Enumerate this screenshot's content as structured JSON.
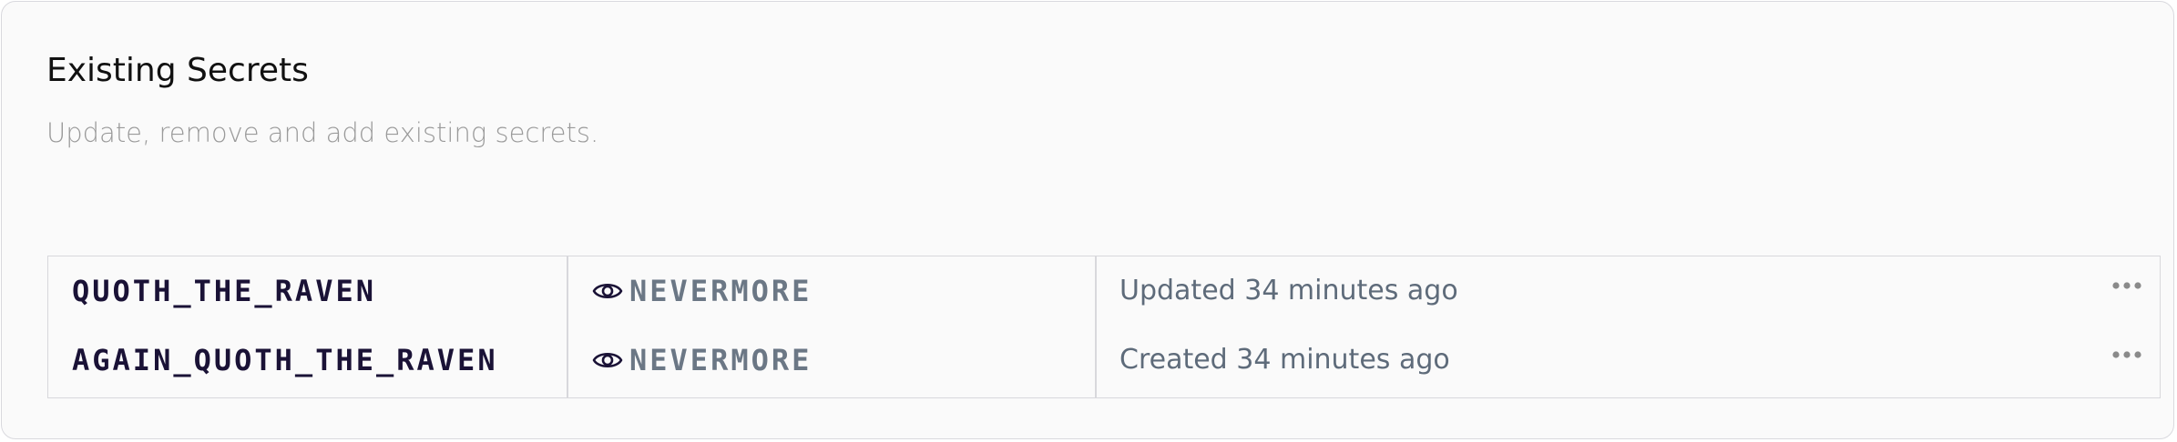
{
  "section": {
    "title": "Existing Secrets",
    "subtitle": "Update, remove and add existing secrets."
  },
  "secrets": [
    {
      "name": "QUOTH_THE_RAVEN",
      "value": "NEVERMORE",
      "status": "Updated 34 minutes ago",
      "reveal_icon": "eye-icon",
      "menu_icon": "more-horizontal-icon"
    },
    {
      "name": "AGAIN_QUOTH_THE_RAVEN",
      "value": "NEVERMORE",
      "status": "Created 34 minutes ago",
      "reveal_icon": "eye-icon",
      "menu_icon": "more-horizontal-icon"
    }
  ],
  "colors": {
    "card_background": "#fafafa",
    "border": "#d8d8dc",
    "title": "#111111",
    "subtitle": "#9a9a9a",
    "secret_name": "#1a1236",
    "secret_value": "#6b7785",
    "status_text": "#5e6b7a",
    "icon": "#1a1236",
    "menu_dots": "#8a8a8a"
  }
}
